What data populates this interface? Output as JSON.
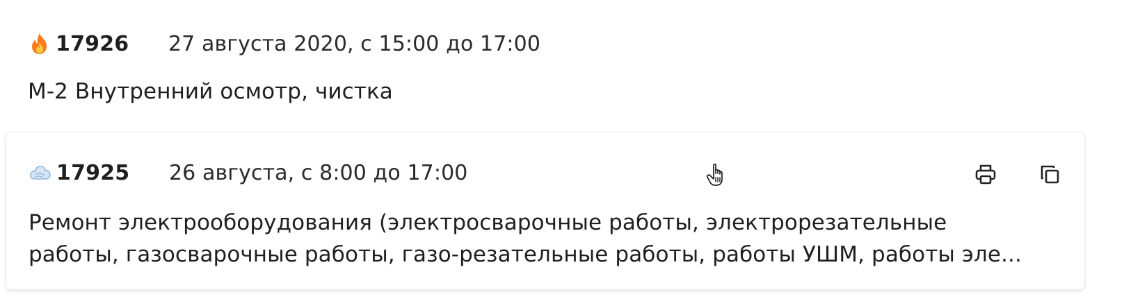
{
  "tickets": [
    {
      "id": "17926",
      "date": "27 августа 2020, с 15:00 до 17:00",
      "description": "М-2 Внутренний осмотр, чистка",
      "status_icon": "fire-icon"
    },
    {
      "id": "17925",
      "date": "26 августа, с 8:00 до 17:00",
      "description": "Ремонт электрооборудования (электросварочные работы, электрорезательные работы, газосварочные работы, газо-резательные работы, работы УШМ, работы эле...",
      "status_icon": "cloud-icon",
      "actions": [
        {
          "name": "print",
          "icon": "printer-icon"
        },
        {
          "name": "copy",
          "icon": "copy-icon"
        }
      ]
    }
  ],
  "colors": {
    "text": "#1f1f1f",
    "fire_orange": "#f57c1f",
    "fire_yellow": "#ffc83d",
    "cloud_blue": "#8fb8de",
    "icon_dark": "#222222"
  }
}
